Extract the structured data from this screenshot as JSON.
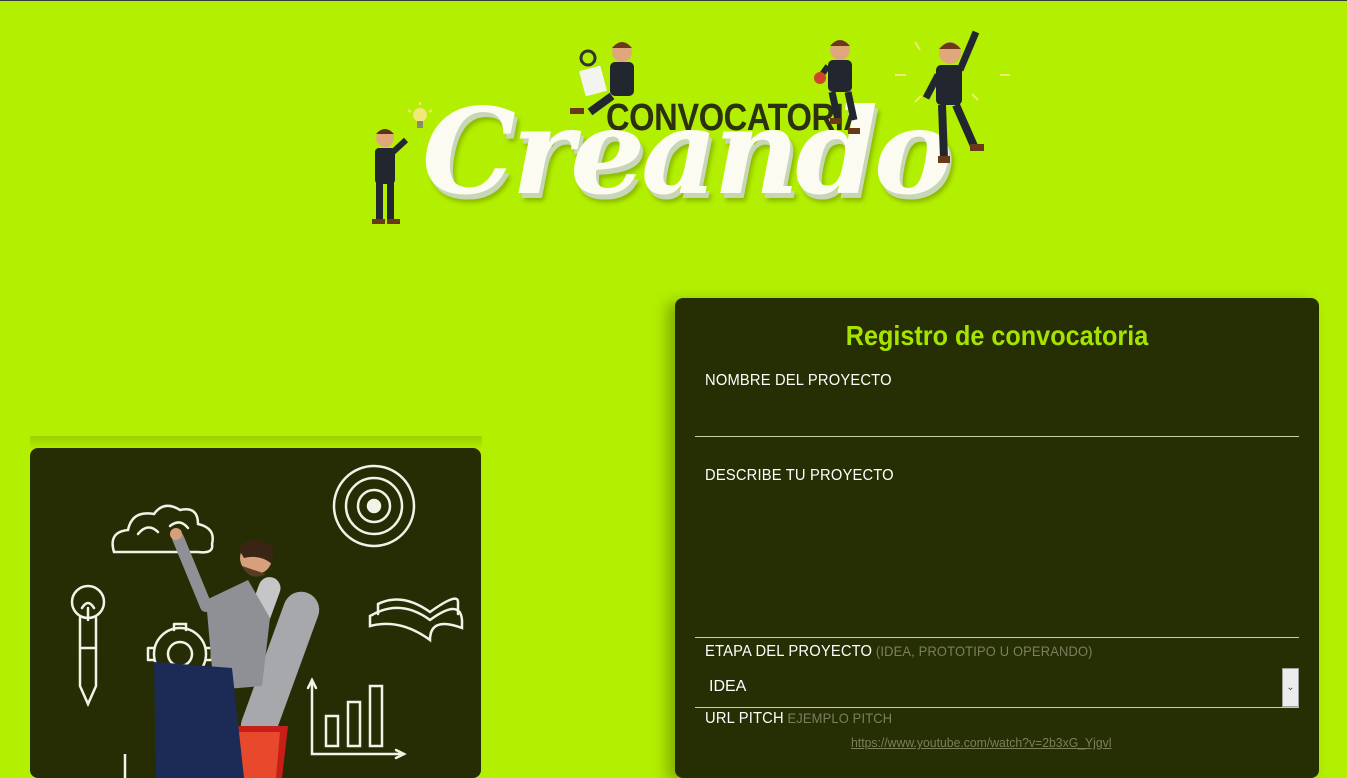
{
  "header": {
    "logo_top_text": "CONVOCATORIA",
    "logo_main_text": "Creando"
  },
  "form": {
    "title": "Registro de convocatoria",
    "project_name": {
      "label": "NOMBRE DEL PROYECTO",
      "value": ""
    },
    "description": {
      "label": "DESCRIBE TU PROYECTO",
      "value": ""
    },
    "stage": {
      "label": "ETAPA DEL PROYECTO",
      "hint": "(IDEA, PROTOTIPO U OPERANDO)",
      "selected": "IDEA"
    },
    "pitch": {
      "label": "URL PITCH",
      "hint": "EJEMPLO PITCH",
      "example_url": "https://www.youtube.com/watch?v=2b3xG_Yjgvl"
    }
  },
  "colors": {
    "page_background": "#b3ef00",
    "panel_background": "#262e04",
    "title_accent": "#a6e400"
  },
  "icons": [
    "lightbulb-icon",
    "cloud-icon",
    "target-icon",
    "gear-icon",
    "pencil-icon",
    "book-icon",
    "bar-chart-icon",
    "jetpack-man-illustration"
  ]
}
